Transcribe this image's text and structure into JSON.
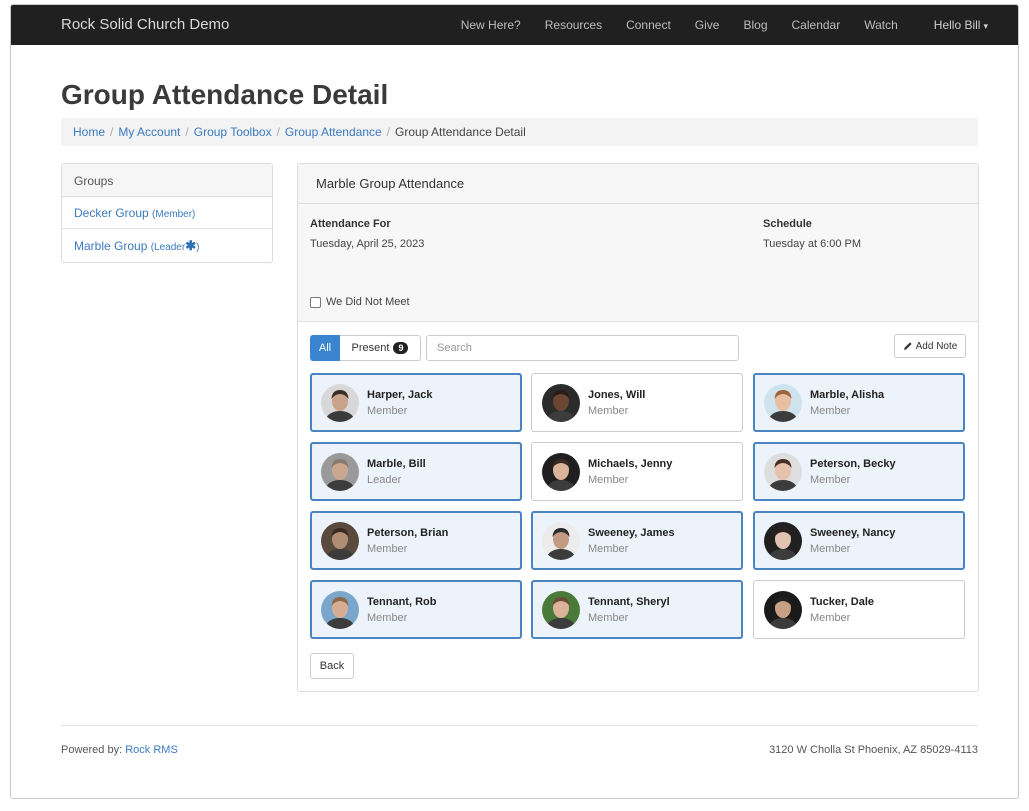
{
  "nav": {
    "brand": "Rock Solid Church Demo",
    "items": [
      "New Here?",
      "Resources",
      "Connect",
      "Give",
      "Blog",
      "Calendar",
      "Watch"
    ],
    "user": "Hello Bill",
    "caret": "▾"
  },
  "page": {
    "title": "Group Attendance Detail"
  },
  "breadcrumb": {
    "items": [
      "Home",
      "My Account",
      "Group Toolbox",
      "Group Attendance"
    ],
    "current": "Group Attendance Detail",
    "separator": "/"
  },
  "groups": {
    "heading": "Groups",
    "items": [
      {
        "name": "Decker Group",
        "role": "(Member)",
        "marker": ""
      },
      {
        "name": "Marble Group",
        "role": "(Leader",
        "marker": "✱",
        "role_close": ")"
      }
    ]
  },
  "attendance": {
    "panel_title": "Marble Group Attendance",
    "attendance_for_label": "Attendance For",
    "attendance_for_value": "Tuesday, April 25, 2023",
    "schedule_label": "Schedule",
    "schedule_value": "Tuesday at 6:00 PM",
    "did_not_meet_label": "We Did Not Meet",
    "did_not_meet_checked": false,
    "filter_all": "All",
    "filter_present": "Present",
    "present_count": "9",
    "search_placeholder": "Search",
    "add_note_label": "Add Note",
    "back_label": "Back",
    "people": [
      {
        "name": "Harper, Jack",
        "role": "Member",
        "present": true,
        "skin": "#c9a38a",
        "hair": "#3a2e28",
        "bg": "#d8d8d8"
      },
      {
        "name": "Jones, Will",
        "role": "Member",
        "present": false,
        "skin": "#6a4633",
        "hair": "#2a1c14",
        "bg": "#2b2b2b"
      },
      {
        "name": "Marble, Alisha",
        "role": "Member",
        "present": true,
        "skin": "#e8bfa3",
        "hair": "#a0643a",
        "bg": "#cfe3ef"
      },
      {
        "name": "Marble, Bill",
        "role": "Leader",
        "present": true,
        "skin": "#caa78f",
        "hair": "#8a7a6e",
        "bg": "#9a9a9a"
      },
      {
        "name": "Michaels, Jenny",
        "role": "Member",
        "present": false,
        "skin": "#dcb49b",
        "hair": "#3b2a22",
        "bg": "#1f1f1f"
      },
      {
        "name": "Peterson, Becky",
        "role": "Member",
        "present": true,
        "skin": "#e6c1ab",
        "hair": "#4a2f25",
        "bg": "#dedede"
      },
      {
        "name": "Peterson, Brian",
        "role": "Member",
        "present": true,
        "skin": "#b08d73",
        "hair": "#3a2a20",
        "bg": "#5a4a3e"
      },
      {
        "name": "Sweeney, James",
        "role": "Member",
        "present": true,
        "skin": "#c39a83",
        "hair": "#2d2d2d",
        "bg": "#ececec"
      },
      {
        "name": "Sweeney, Nancy",
        "role": "Member",
        "present": true,
        "skin": "#e2c2b0",
        "hair": "#2a1f1c",
        "bg": "#202020"
      },
      {
        "name": "Tennant, Rob",
        "role": "Member",
        "present": true,
        "skin": "#d6ad92",
        "hair": "#8a6848",
        "bg": "#7aa6cc"
      },
      {
        "name": "Tennant, Sheryl",
        "role": "Member",
        "present": true,
        "skin": "#dbb39a",
        "hair": "#6a4e34",
        "bg": "#4a7a3a"
      },
      {
        "name": "Tucker, Dale",
        "role": "Member",
        "present": false,
        "skin": "#c7a086",
        "hair": "#1e1e1e",
        "bg": "#1a1a1a"
      }
    ]
  },
  "footer": {
    "powered_by": "Powered by:",
    "powered_link": "Rock RMS",
    "address": "3120 W Cholla St Phoenix, AZ 85029-4113"
  },
  "colors": {
    "accent": "#3b84cf",
    "link": "#3a7ac0",
    "present_border": "#4a84c1",
    "present_bg": "#edf3fa",
    "navbar": "#202020"
  }
}
